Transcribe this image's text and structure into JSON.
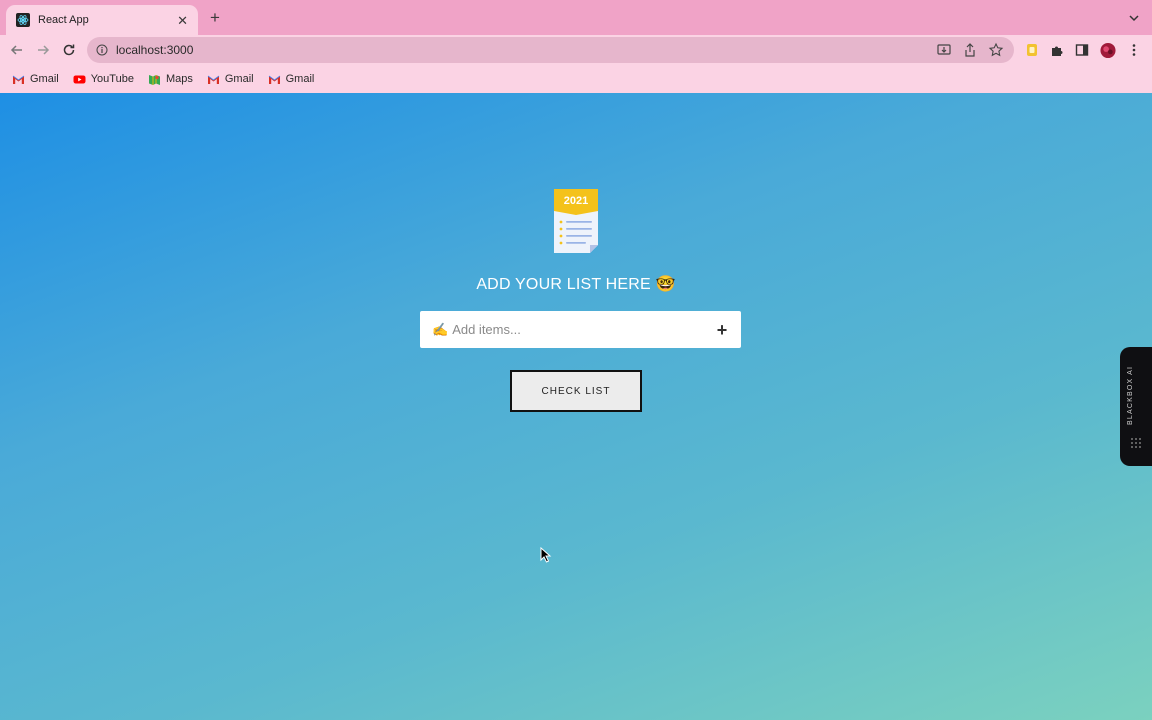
{
  "browser": {
    "tab_title": "React App",
    "close_glyph": "✕",
    "new_tab_glyph": "+",
    "url": "localhost:3000"
  },
  "bookmarks": [
    {
      "label": "Gmail",
      "icon": "gmail-icon"
    },
    {
      "label": "YouTube",
      "icon": "youtube-icon"
    },
    {
      "label": "Maps",
      "icon": "maps-icon"
    },
    {
      "label": "Gmail",
      "icon": "gmail-icon"
    },
    {
      "label": "Gmail",
      "icon": "gmail-icon"
    }
  ],
  "page": {
    "badge_year": "2021",
    "heading": "ADD YOUR LIST HERE 🤓",
    "input_prefix": "✍",
    "input_placeholder": "Add items...",
    "add_glyph": "+",
    "check_button": "CHECK LIST"
  },
  "extension": {
    "label": "BLACKBOX AI"
  },
  "colors": {
    "tab_strip": "#f0a3c7",
    "toolbar": "#fbd3e4",
    "gradient_start": "#1e8fe4",
    "gradient_end": "#7bd1bf"
  }
}
